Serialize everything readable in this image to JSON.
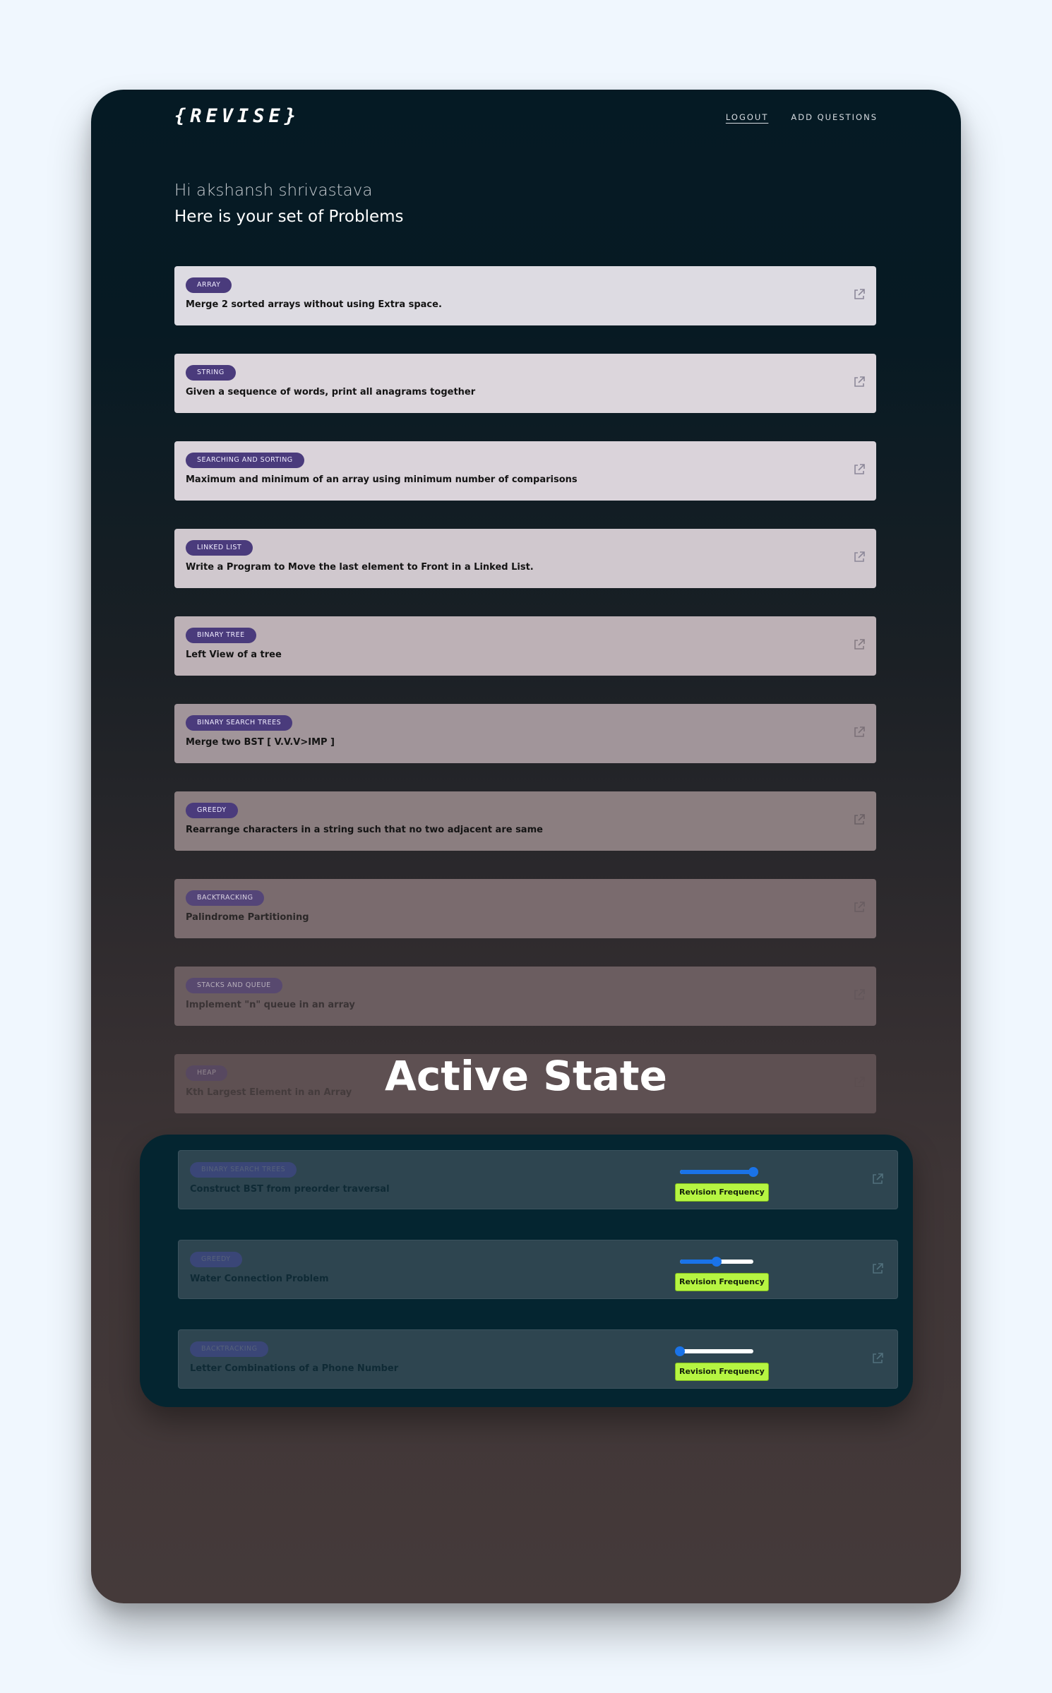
{
  "app": {
    "logo": "{REVISE}",
    "nav": [
      {
        "label": "LOGOUT"
      },
      {
        "label": "ADD QUESTIONS"
      }
    ]
  },
  "greeting": "Hi akshansh shrivastava",
  "subheading": "Here is your set of Problems",
  "questions": [
    {
      "tag": "ARRAY",
      "title": "Merge 2 sorted arrays without using Extra space."
    },
    {
      "tag": "STRING",
      "title": "Given a sequence of words, print all anagrams together"
    },
    {
      "tag": "SEARCHING AND SORTING",
      "title": "Maximum and minimum of an array using minimum number of comparisons"
    },
    {
      "tag": "LINKED LIST",
      "title": "Write a Program to Move the last element to Front in a Linked List."
    },
    {
      "tag": "BINARY TREE",
      "title": "Left View of a tree"
    },
    {
      "tag": "BINARY SEARCH TREES",
      "title": "Merge two BST [ V.V.V>IMP ]"
    },
    {
      "tag": "GREEDY",
      "title": "Rearrange characters in a string such that no two adjacent are same"
    },
    {
      "tag": "BACKTRACKING",
      "title": "Palindrome Partitioning"
    },
    {
      "tag": "STACKS AND QUEUE",
      "title": "Implement \"n\" queue in an array"
    },
    {
      "tag": "HEAP",
      "title": "Kth Largest Element in an Array"
    }
  ],
  "overlay_label": "Active State",
  "active_questions": [
    {
      "tag": "BINARY SEARCH TREES",
      "title": "Construct BST from preorder traversal",
      "revision_level": 1.0,
      "button": "Revision Frequency"
    },
    {
      "tag": "GREEDY",
      "title": "Water Connection Problem",
      "revision_level": 0.5,
      "button": "Revision Frequency"
    },
    {
      "tag": "BACKTRACKING",
      "title": "Letter Combinations of a Phone Number",
      "revision_level": 0.0,
      "button": "Revision Frequency"
    }
  ],
  "colors": {
    "tag_bg": "#4a3b7c",
    "slider_accent": "#1a73e8",
    "revision_button": "#b6f542"
  }
}
